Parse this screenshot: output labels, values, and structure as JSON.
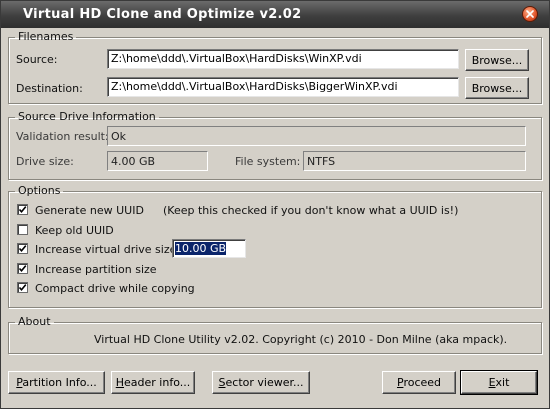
{
  "window": {
    "title": "Virtual HD Clone and Optimize v2.02"
  },
  "filenames": {
    "legend": "Filenames",
    "source_label": "Source:",
    "source_value": "Z:\\home\\ddd\\.VirtualBox\\HardDisks\\WinXP.vdi",
    "destination_label": "Destination:",
    "destination_value": "Z:\\home\\ddd\\.VirtualBox\\HardDisks\\BiggerWinXP.vdi",
    "browse_label": "Browse..."
  },
  "source_info": {
    "legend": "Source Drive Information",
    "validation_label": "Validation result:",
    "validation_value": "Ok",
    "drive_size_label": "Drive size:",
    "drive_size_value": "4.00 GB",
    "file_system_label": "File system:",
    "file_system_value": "NTFS"
  },
  "options": {
    "legend": "Options",
    "generate_uuid": {
      "label": "Generate new UUID",
      "checked": true
    },
    "uuid_hint": "(Keep this checked if you don't know what a UUID is!)",
    "keep_uuid": {
      "label": "Keep old UUID",
      "checked": false
    },
    "increase_size": {
      "label": "Increase virtual drive size to",
      "checked": true
    },
    "increase_size_value": "10.00 GB",
    "increase_partition": {
      "label": "Increase partition size",
      "checked": true
    },
    "compact": {
      "label": "Compact drive while copying",
      "checked": true
    }
  },
  "about": {
    "legend": "About",
    "text": "Virtual HD Clone Utility v2.02. Copyright (c) 2010 - Don Milne (aka mpack)."
  },
  "buttons": {
    "partition_info_accel": "P",
    "partition_info_rest": "artition Info...",
    "header_info_accel": "H",
    "header_info_rest": "eader info...",
    "sector_viewer_accel": "S",
    "sector_viewer_rest": "ector viewer...",
    "proceed_accel": "P",
    "proceed_rest": "roceed",
    "exit_accel": "E",
    "exit_rest": "xit"
  }
}
